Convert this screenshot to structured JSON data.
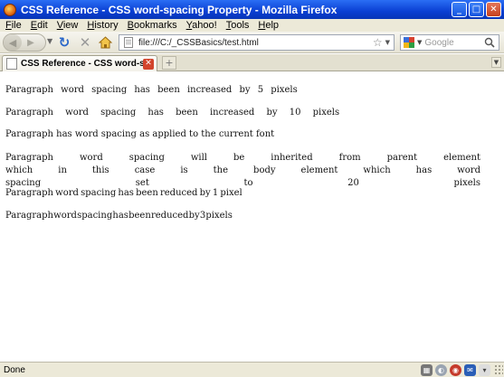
{
  "window": {
    "title": "CSS Reference - CSS word-spacing Property - Mozilla Firefox",
    "minimize_glyph": "_",
    "maximize_glyph": "□",
    "close_glyph": "✕"
  },
  "menubar": {
    "items": [
      "File",
      "Edit",
      "View",
      "History",
      "Bookmarks",
      "Yahoo!",
      "Tools",
      "Help"
    ]
  },
  "navbar": {
    "url": "file:///C:/_CSSBasics/test.html",
    "search_placeholder": "Google",
    "back_icon": "back-arrow-icon",
    "forward_icon": "forward-arrow-icon",
    "reload_icon": "reload-icon",
    "stop_icon": "stop-icon",
    "home_icon": "home-icon"
  },
  "tabs": [
    {
      "title": "CSS Reference - CSS word-spacin...",
      "active": true
    }
  ],
  "content": {
    "paragraphs": [
      "Paragraph word spacing has been increased by 5 pixels",
      "Paragraph word spacing has been increased by 10 pixels",
      "Paragraph has word spacing as applied to the current font",
      "Paragraph word spacing will be inherited from parent element which in this case is the body element which has word spacing set to 20 pixels",
      "Paragraph word spacing has been reduced by 1 pixel",
      "Paragraph word spacing has been reduced by 3 pixels"
    ]
  },
  "statusbar": {
    "text": "Done"
  },
  "colors": {
    "titlebar": "#0a3fd3",
    "chrome": "#ece9d8",
    "tab_close": "#d2442c",
    "reload": "#2a67c9"
  }
}
